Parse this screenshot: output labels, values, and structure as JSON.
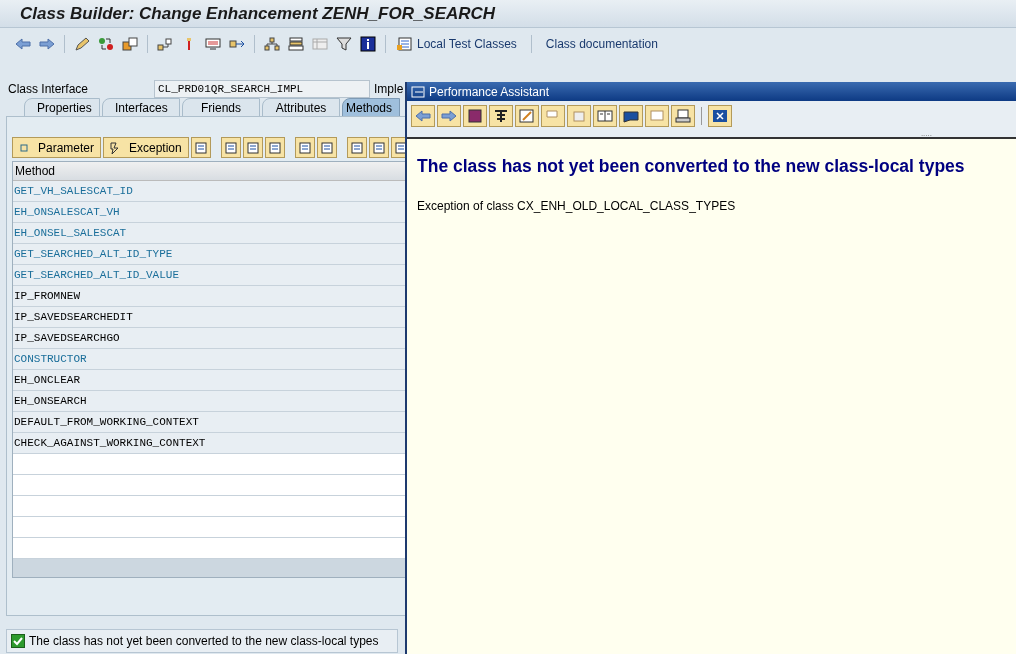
{
  "window": {
    "title": "Class Builder: Change Enhancement ZENH_FOR_SEARCH"
  },
  "toolbar": {
    "links": [
      "Local Test Classes",
      "Class documentation"
    ]
  },
  "class_interface": {
    "label": "Class Interface",
    "value": "CL_PRD01QR_SEARCH_IMPL",
    "status": "Imple"
  },
  "tabs": [
    {
      "label": "Properties",
      "selected": false
    },
    {
      "label": "Interfaces",
      "selected": false
    },
    {
      "label": "Friends",
      "selected": false
    },
    {
      "label": "Attributes",
      "selected": false
    },
    {
      "label": "Methods",
      "selected": true
    }
  ],
  "method_buttons": [
    "Parameter",
    "Exception"
  ],
  "table": {
    "columns": [
      "Method"
    ],
    "rows": [
      {
        "name": "GET_VH_SALESCAT_ID",
        "inherited": true
      },
      {
        "name": "EH_ONSALESCAT_VH",
        "inherited": true
      },
      {
        "name": "EH_ONSEL_SALESCAT",
        "inherited": true
      },
      {
        "name": "GET_SEARCHED_ALT_ID_TYPE",
        "inherited": true
      },
      {
        "name": "GET_SEARCHED_ALT_ID_VALUE",
        "inherited": true
      },
      {
        "name": "IP_FROMNEW",
        "inherited": false
      },
      {
        "name": "IP_SAVEDSEARCHEDIT",
        "inherited": false
      },
      {
        "name": "IP_SAVEDSEARCHGO",
        "inherited": false
      },
      {
        "name": "CONSTRUCTOR",
        "inherited": true
      },
      {
        "name": "EH_ONCLEAR",
        "inherited": false
      },
      {
        "name": "EH_ONSEARCH",
        "inherited": false
      },
      {
        "name": "DEFAULT_FROM_WORKING_CONTEXT",
        "inherited": false
      },
      {
        "name": "CHECK_AGAINST_WORKING_CONTEXT",
        "inherited": false
      }
    ]
  },
  "status_bar": {
    "message": "The class has not yet been converted to the new class-local types"
  },
  "popup": {
    "title": "Performance Assistant",
    "heading": "The class has not yet been converted to the new class-local types",
    "text": "Exception of class CX_ENH_OLD_LOCAL_CLASS_TYPES",
    "grip": "....."
  }
}
